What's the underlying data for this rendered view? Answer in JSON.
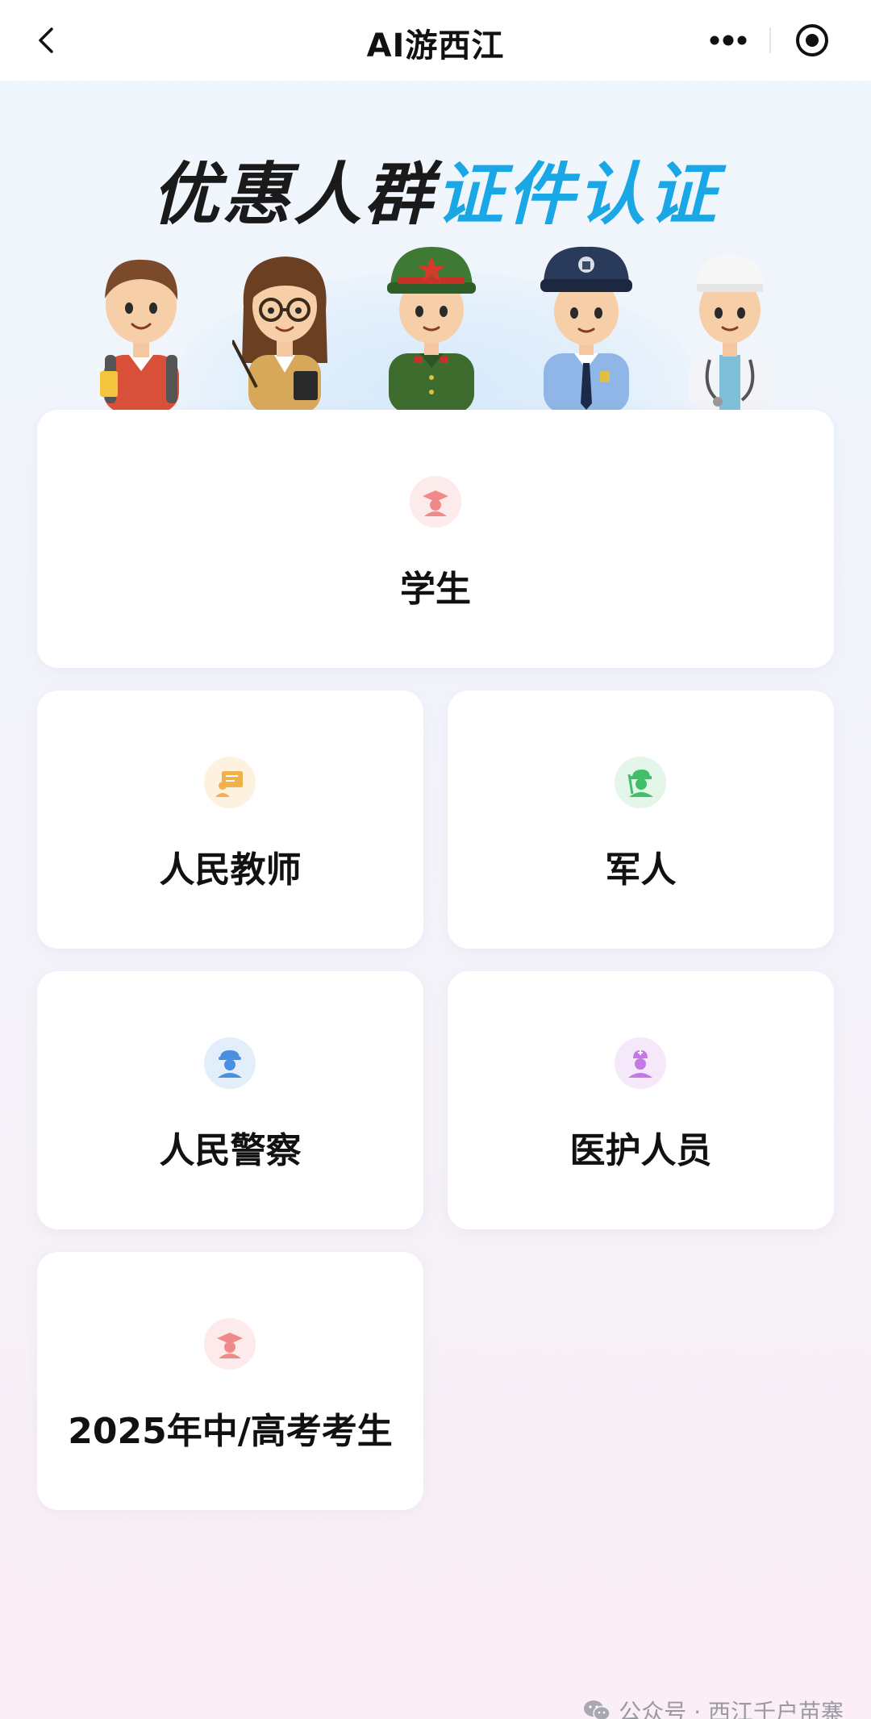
{
  "app": {
    "title": "AI游西江"
  },
  "nav": {
    "back_icon": "chevron-left-icon",
    "more_icon": "more-dots-icon",
    "close_icon": "target-circle-icon"
  },
  "banner": {
    "title_part1": "优惠人群",
    "title_part2": "证件认证",
    "accent_color": "#1aa7e6",
    "figures": [
      "student",
      "teacher",
      "soldier",
      "police",
      "doctor"
    ]
  },
  "cards": [
    {
      "label": "学生",
      "icon": "student-icon",
      "color": "#f08a8a"
    },
    {
      "label": "人民教师",
      "icon": "teacher-icon",
      "color": "#f2b04a"
    },
    {
      "label": "军人",
      "icon": "soldier-icon",
      "color": "#3fbf6a"
    },
    {
      "label": "人民警察",
      "icon": "police-icon",
      "color": "#4a90e2"
    },
    {
      "label": "医护人员",
      "icon": "medical-icon",
      "color": "#c478e6"
    },
    {
      "label": "2025年中/高考考生",
      "icon": "exam-student-icon",
      "color": "#f08a8a"
    }
  ],
  "footer": {
    "watermark": "公众号 · 西江千户苗寨"
  }
}
